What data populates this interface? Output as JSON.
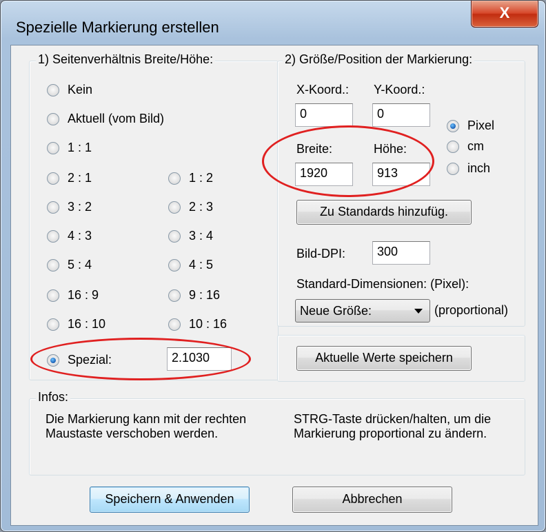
{
  "window": {
    "title": "Spezielle Markierung erstellen",
    "close_label": "X"
  },
  "aspect": {
    "legend": "1) Seitenverhältnis Breite/Höhe:",
    "options": [
      "Kein",
      "Aktuell (vom Bild)",
      "1 : 1",
      "2 : 1",
      "1 : 2",
      "3 : 2",
      "2 : 3",
      "4 : 3",
      "3 : 4",
      "5 : 4",
      "4 : 5",
      "16 : 9",
      "9 : 16",
      "16 : 10",
      "10 : 16"
    ],
    "special_label": "Spezial:",
    "special_value": "2.1030",
    "selected": "Spezial:"
  },
  "size": {
    "legend": "2) Größe/Position der Markierung:",
    "x_label": "X-Koord.:",
    "x_value": "0",
    "y_label": "Y-Koord.:",
    "y_value": "0",
    "width_label": "Breite:",
    "width_value": "1920",
    "height_label": "Höhe:",
    "height_value": "913",
    "units": [
      "Pixel",
      "cm",
      "inch"
    ],
    "unit_selected": "Pixel",
    "add_button": "Zu Standards hinzufüg.",
    "dpi_label": "Bild-DPI:",
    "dpi_value": "300",
    "std_label": "Standard-Dimensionen: (Pixel):",
    "std_select": "Neue Größe:",
    "proportional_label": "(proportional)",
    "save_values_button": "Aktuelle Werte speichern"
  },
  "info": {
    "legend": "Infos:",
    "left_text": "Die Markierung kann mit der rechten Maustaste verschoben werden.",
    "right_text": "STRG-Taste drücken/halten, um die Markierung proportional zu ändern."
  },
  "footer": {
    "apply_button": "Speichern & Anwenden",
    "cancel_button": "Abbrechen"
  },
  "colors": {
    "highlight": "#e02020",
    "accent": "#1a5fb4"
  }
}
